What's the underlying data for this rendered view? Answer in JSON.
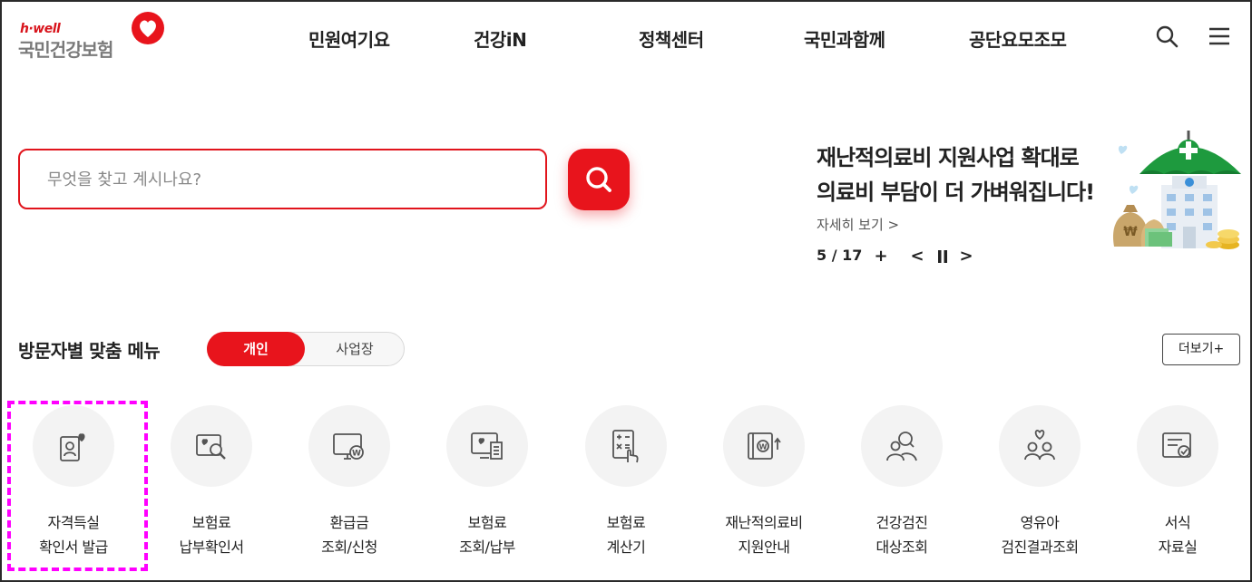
{
  "logo": {
    "tagline": "h·well",
    "name": "국민건강보험"
  },
  "nav": {
    "items": [
      {
        "label": "민원여기요"
      },
      {
        "label": "건강iN"
      },
      {
        "label": "정책센터"
      },
      {
        "label": "국민과함께"
      },
      {
        "label": "공단요모조모"
      }
    ],
    "search_icon": "search-icon",
    "menu_icon": "hamburger-menu-icon"
  },
  "search": {
    "placeholder": "무엇을 찾고 계시나요?",
    "value": ""
  },
  "banner": {
    "title_line1": "재난적의료비 지원사업 확대로",
    "title_line2": "의료비 부담이 더 가벼워집니다!",
    "more": "자세히 보기 >",
    "current": "5",
    "total": "17",
    "counter": "5 / 17",
    "plus": "+",
    "prev": "<",
    "next": ">"
  },
  "visitor_menu": {
    "title": "방문자별 맞춤 메뉴",
    "tabs": [
      {
        "label": "개인",
        "selected": true
      },
      {
        "label": "사업장",
        "selected": false
      }
    ],
    "more": "더보기+"
  },
  "quick_menu": [
    {
      "line1": "자격득실",
      "line2": "확인서 발급",
      "icon": "certificate-heart-icon"
    },
    {
      "line1": "보험료",
      "line2": "납부확인서",
      "icon": "document-search-icon"
    },
    {
      "line1": "환급금",
      "line2": "조회/신청",
      "icon": "monitor-won-icon"
    },
    {
      "line1": "보험료",
      "line2": "조회/납부",
      "icon": "screen-receipt-icon"
    },
    {
      "line1": "보험료",
      "line2": "계산기",
      "icon": "calculator-hand-icon"
    },
    {
      "line1": "재난적의료비",
      "line2": "지원안내",
      "icon": "book-won-icon"
    },
    {
      "line1": "건강검진",
      "line2": "대상조회",
      "icon": "people-search-icon"
    },
    {
      "line1": "영유아",
      "line2": "검진결과조회",
      "icon": "family-heart-icon"
    },
    {
      "line1": "서식",
      "line2": "자료실",
      "icon": "form-document-icon"
    }
  ],
  "colors": {
    "brand_red": "#e8141c",
    "highlight": "#ff00ff",
    "icon_gray": "#555555"
  }
}
